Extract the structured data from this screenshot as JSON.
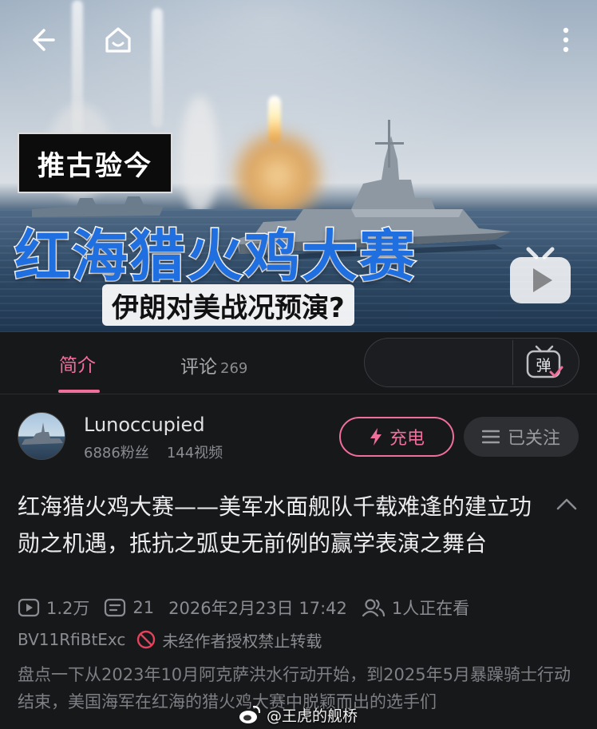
{
  "video": {
    "thumbnail_tag": "推古验今",
    "thumbnail_title": "红海猎火鸡大赛",
    "thumbnail_subtitle": "伊朗对美战况预演?"
  },
  "tabs": {
    "intro_label": "简介",
    "comments_label": "评论",
    "comments_count": "269"
  },
  "danmaku": {
    "placeholder": "",
    "button_label": "弹"
  },
  "uploader": {
    "name": "Lunoccupied",
    "followers": "6886粉丝",
    "videos": "144视频",
    "charge_label": "充电",
    "follow_label": "已关注"
  },
  "title": "红海猎火鸡大赛——美军水面舰队千载难逢的建立功勋之机遇，抵抗之弧史无前例的赢学表演之舞台",
  "meta": {
    "views": "1.2万",
    "danmaku_count": "21",
    "datetime": "2026年2月23日 17:42",
    "watching": "1人正在看",
    "bvid": "BV11RfiBtExc",
    "repost_notice": "未经作者授权禁止转载"
  },
  "description": "盘点一下从2023年10月阿克萨洪水行动开始，到2025年5月暴躁骑士行动结束，美国海军在红海的猎火鸡大赛中脱颖而出的选手们",
  "watermark": "@王虎的舰桥",
  "colors": {
    "accent_pink": "#f06f9a",
    "background": "#17181a",
    "title_blue": "#1f6fe0"
  }
}
